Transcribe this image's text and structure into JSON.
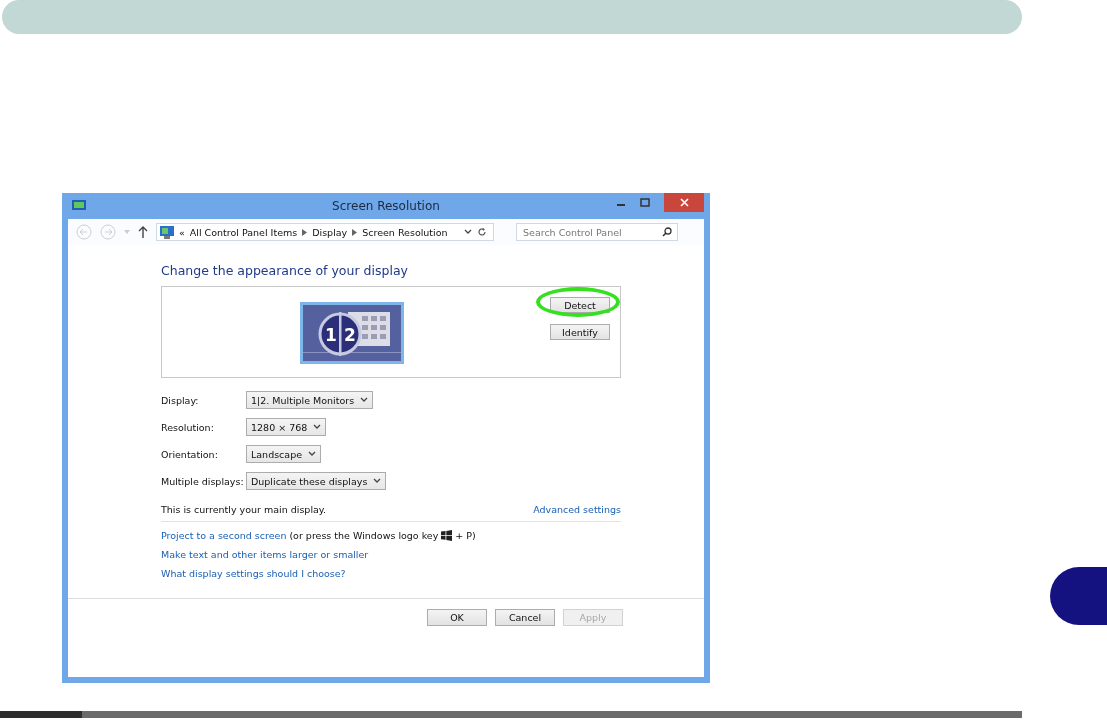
{
  "window": {
    "title": "Screen Resolution"
  },
  "address_bar": {
    "overflow": "«",
    "breadcrumbs": [
      "All Control Panel Items",
      "Display",
      "Screen Resolution"
    ]
  },
  "search": {
    "placeholder": "Search Control Panel"
  },
  "heading": "Change the appearance of your display",
  "monitor_preview": {
    "numbers": [
      "1",
      "2"
    ]
  },
  "preview_buttons": [
    {
      "label": "Detect",
      "highlighted": true
    },
    {
      "label": "Identify",
      "highlighted": false
    }
  ],
  "settings": [
    {
      "label": "Display:",
      "value": "1|2. Multiple Monitors"
    },
    {
      "label": "Resolution:",
      "value": "1280 × 768"
    },
    {
      "label": "Orientation:",
      "value": "Landscape"
    },
    {
      "label": "Multiple displays:",
      "value": "Duplicate these displays"
    }
  ],
  "main_display_note": "This is currently your main display.",
  "advanced_link": "Advanced settings",
  "project": {
    "link": "Project to a second screen",
    "note_start": "(or press the Windows logo key",
    "note_end": "+ P)"
  },
  "links": [
    "Make text and other items larger or smaller",
    "What display settings should I choose?"
  ],
  "buttons": [
    {
      "label": "OK",
      "disabled": false
    },
    {
      "label": "Cancel",
      "disabled": false
    },
    {
      "label": "Apply",
      "disabled": true
    }
  ]
}
